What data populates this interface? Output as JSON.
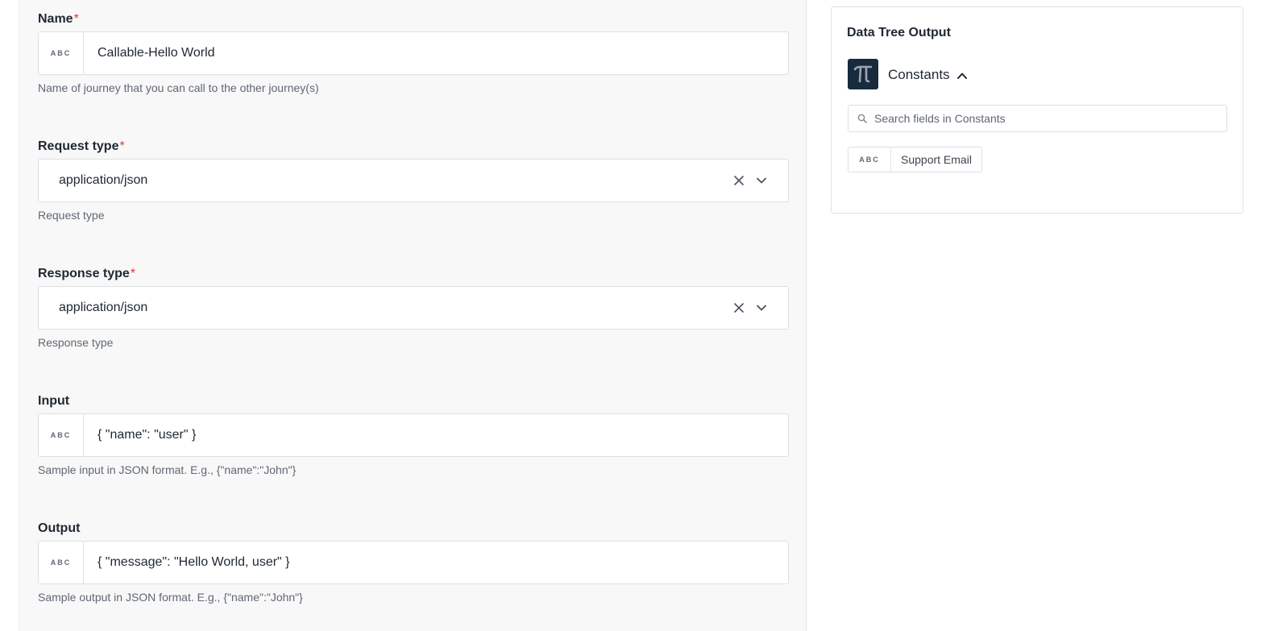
{
  "form": {
    "name": {
      "label": "Name",
      "required_mark": "*",
      "type_badge": "ABC",
      "value": "Callable-Hello World",
      "helper": "Name of journey that you can call to the other journey(s)"
    },
    "request_type": {
      "label": "Request type",
      "required_mark": "*",
      "value": "application/json",
      "helper": "Request type"
    },
    "response_type": {
      "label": "Response type",
      "required_mark": "*",
      "value": "application/json",
      "helper": "Response type"
    },
    "input": {
      "label": "Input",
      "type_badge": "ABC",
      "value": "{ \"name\": \"user\" }",
      "helper": "Sample input in JSON format. E.g., {\"name\":\"John\"}"
    },
    "output": {
      "label": "Output",
      "type_badge": "ABC",
      "value": "{ \"message\": \"Hello World, user\" }",
      "helper": "Sample output in JSON format. E.g., {\"name\":\"John\"}"
    }
  },
  "data_tree": {
    "title": "Data Tree Output",
    "group": {
      "icon": "pi-icon",
      "name": "Constants",
      "expanded": true
    },
    "search": {
      "placeholder": "Search fields in Constants"
    },
    "fields": [
      {
        "type_badge": "ABC",
        "label": "Support Email"
      }
    ]
  },
  "icons": {
    "clear": "close-icon",
    "dropdown": "chevron-down-icon",
    "collapse": "chevron-up-icon",
    "search": "search-icon"
  },
  "colors": {
    "required": "#d83b3b",
    "pi_tile": "#172a3e",
    "panel_bg": "#f8f8f8"
  }
}
